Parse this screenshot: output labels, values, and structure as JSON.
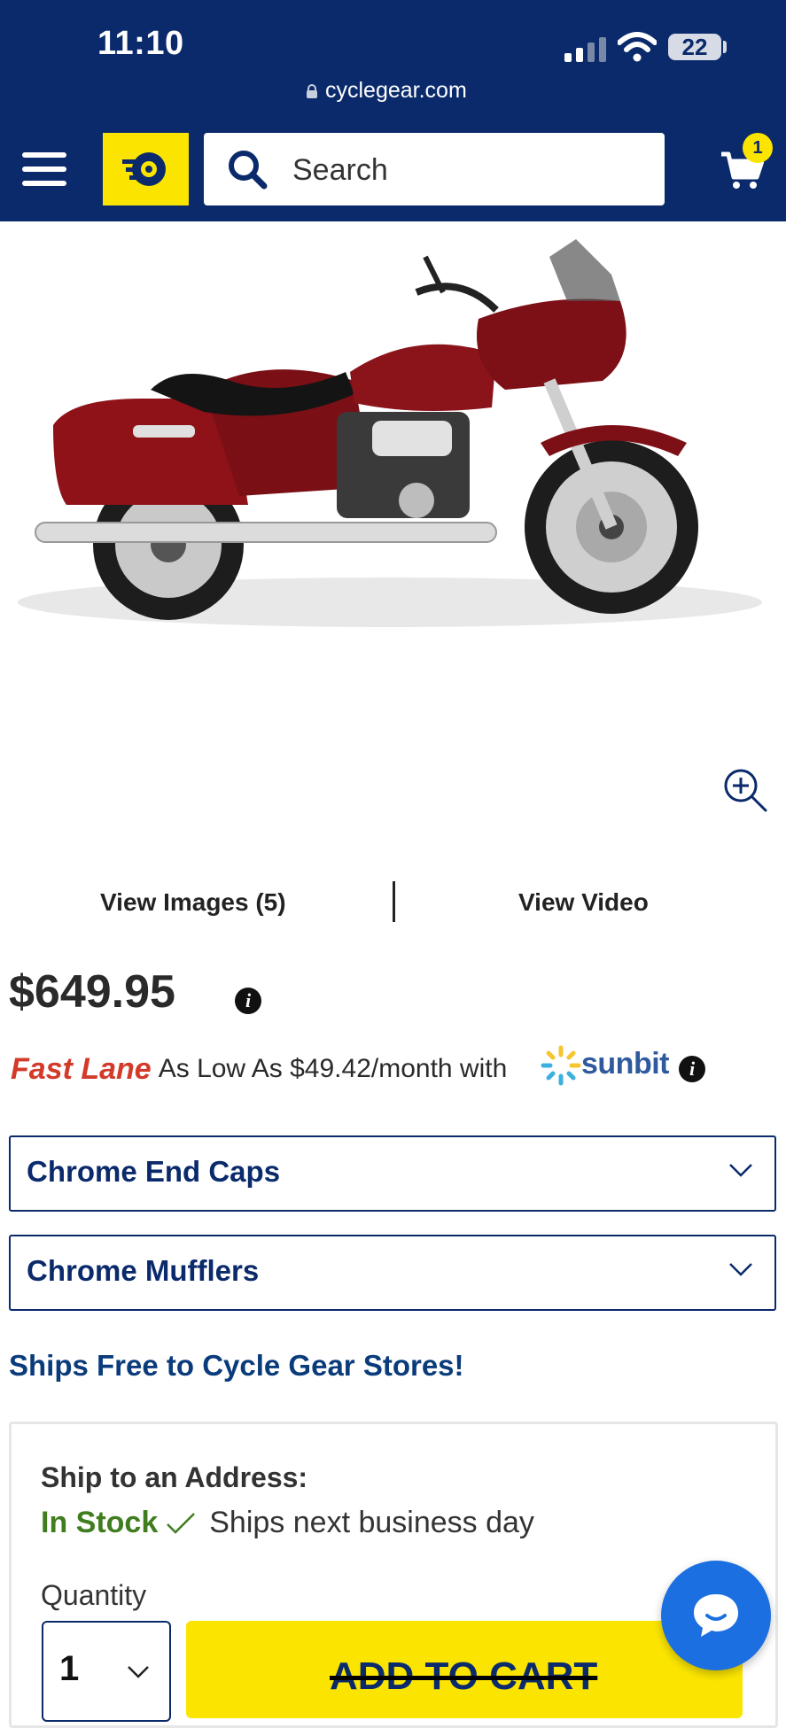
{
  "status_bar": {
    "time": "11:10",
    "battery": "22"
  },
  "browser": {
    "url": "cyclegear.com"
  },
  "header": {
    "search_placeholder": "Search",
    "cart_count": "1",
    "brand_color": "#0a2a6b",
    "accent_color": "#fbe500"
  },
  "media": {
    "view_images_label": "View Images (5)",
    "view_video_label": "View Video"
  },
  "pricing": {
    "price": "$649.95",
    "fast_lane": "Fast Lane",
    "monthly_text": "As Low As $49.42/month with",
    "financing_brand": "sunbit"
  },
  "options": [
    {
      "label": "Chrome End Caps"
    },
    {
      "label": "Chrome Mufflers"
    }
  ],
  "ships_free": "Ships Free to Cycle Gear Stores!",
  "shipping": {
    "title": "Ship to an Address:",
    "stock_status": "In Stock",
    "ships_text": "Ships next business day",
    "quantity_label": "Quantity",
    "quantity_value": "1",
    "add_to_cart_label": "ADD TO CART"
  }
}
